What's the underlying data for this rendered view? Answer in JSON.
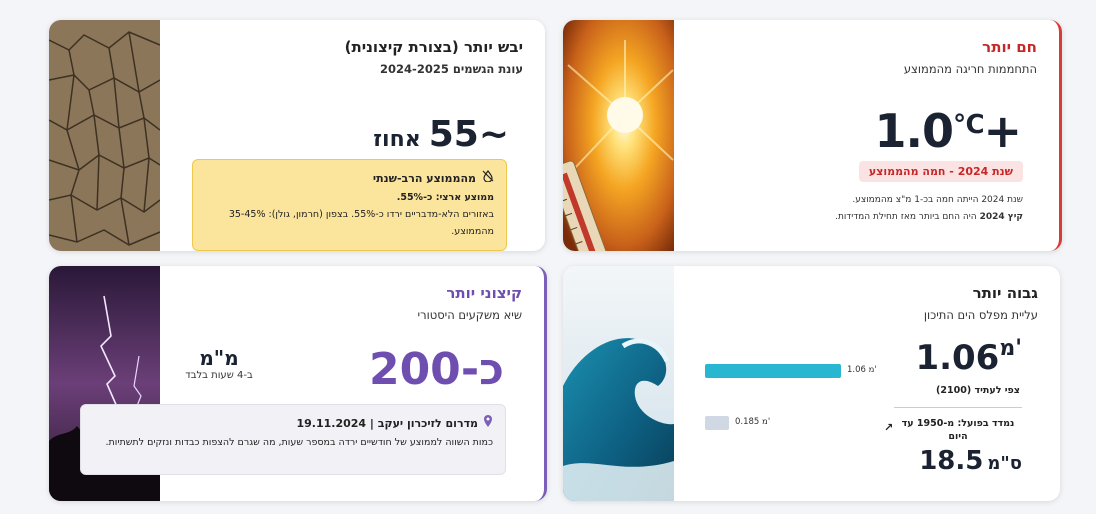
{
  "cards": {
    "hot": {
      "title": "חם יותר",
      "subtitle": "התחממות חריגה מהממוצע",
      "value": "1.0",
      "unit": "℃",
      "sign": "+",
      "badge": "שנת 2024 - חמה מהממוצע",
      "note_line1": "שנת 2024 הייתה חמה בכ-1 מ\"צ מהממוצע.",
      "note_line2_bold": "קיץ 2024",
      "note_line2_rest": " היה החם ביותר מאז תחילת המדידות."
    },
    "dry": {
      "title": "יבש יותר (בצורת קיצונית)",
      "subtitle": "עונת הגשמים 2024-2025",
      "value": "55~",
      "unit": "אחוז",
      "info_title": "מהממוצע הרב-שנתי",
      "info_line1": "ממוצע ארצי: כ-55%.",
      "info_line2": "באזורים הלא-מדבריים ירדו כ-55%. בצפון (חרמון, גולן): 35-45% מהממוצע."
    },
    "high": {
      "title": "גבוה יותר",
      "subtitle": "עליית מפלס הים התיכון",
      "value": "1.06",
      "unit": "מ'",
      "forecast_label": "צפי לעתיד (2100)",
      "measured_label": "נמדד בפועל: מ-1950 עד היום",
      "measured_value": "18.5",
      "measured_unit": "ס\"מ",
      "bar1_label": "1.06 מ'",
      "bar2_label": "0.185 מ'"
    },
    "extreme": {
      "title": "קיצוני יותר",
      "subtitle": "שיא משקעים היסטורי",
      "value": "כ-200",
      "unit": "מ\"מ",
      "unit_sub": "ב-4 שעות בלבד",
      "location_title": "מדרום לזיכרון יעקב | 19.11.2024",
      "location_text": "כמות השווה לממוצע של חודשיים ירדה במספר שעות, מה שגרם להצפות כבדות ונזקים לתשתיות."
    }
  },
  "chart_data": {
    "type": "bar",
    "categories": [
      "צפי לעתיד (2100)",
      "נמדד בפועל: מ-1950 עד היום"
    ],
    "values": [
      1.06,
      0.185
    ],
    "unit": "מ'",
    "colors": [
      "#29b6d0",
      "#cfd8e3"
    ]
  },
  "icons": {
    "dry_info": "no-rain-icon",
    "location": "map-pin-icon",
    "trend": "trend-up-icon"
  },
  "colors": {
    "hot_accent": "#d83a3a",
    "extreme_accent": "#6e4fb0",
    "dry_box": "#fbe59c",
    "bar_main": "#29b6d0"
  }
}
